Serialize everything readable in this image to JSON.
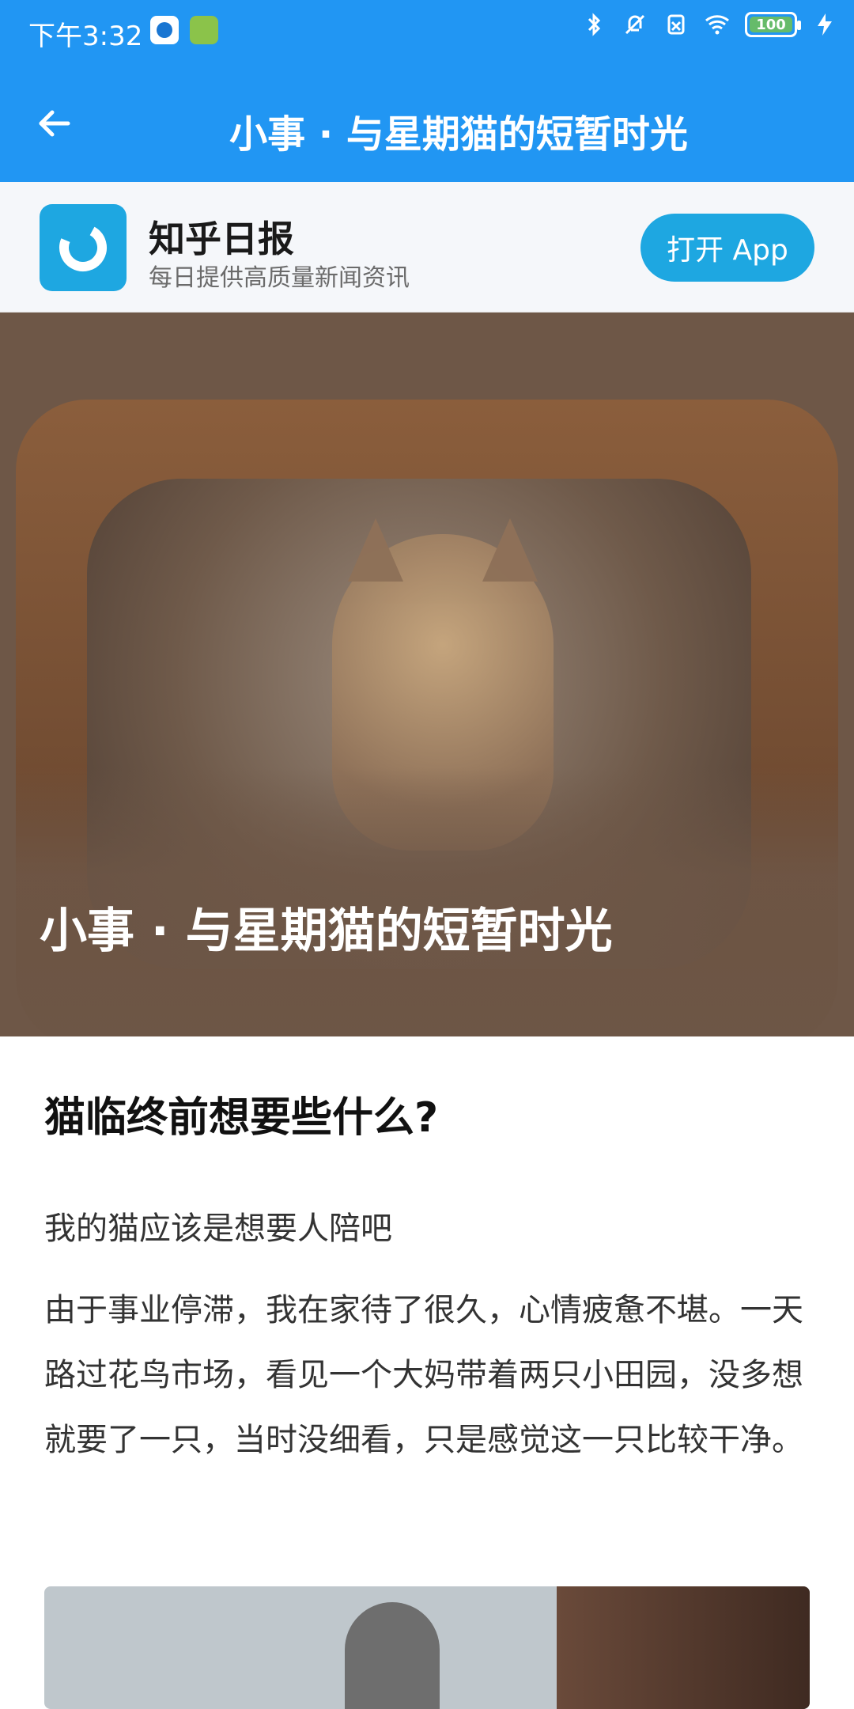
{
  "status_bar": {
    "time": "下午3:32",
    "battery_level": "100"
  },
  "header": {
    "title": "小事 · 与星期猫的短暂时光"
  },
  "banner": {
    "app_name": "知乎日报",
    "app_desc": "每日提供高质量新闻资讯",
    "open_label": "打开 App"
  },
  "hero": {
    "title": "小事 · 与星期猫的短暂时光"
  },
  "article": {
    "question_title": "猫临终前想要些什么?",
    "subhead": "我的猫应该是想要人陪吧",
    "paragraph": "由于事业停滞，我在家待了很久，心情疲惫不堪。一天路过花鸟市场，看见一个大妈带着两只小田园，没多想就要了一只，当时没细看，只是感觉这一只比较干净。"
  },
  "colors": {
    "top_bar": "#2196f3",
    "brand": "#1ea7e1"
  },
  "icons": [
    "back-arrow-icon",
    "bluetooth-icon",
    "mute-icon",
    "sim-icon",
    "wifi-icon",
    "battery-icon",
    "charging-icon"
  ]
}
